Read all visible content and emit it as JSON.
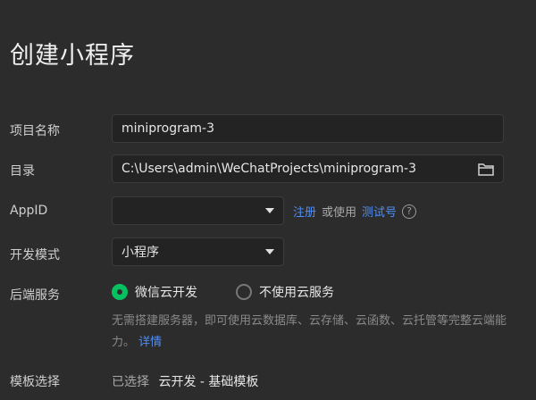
{
  "title": "创建小程序",
  "fields": {
    "project_name": {
      "label": "项目名称",
      "value": "miniprogram-3"
    },
    "directory": {
      "label": "目录",
      "value": "C:\\Users\\admin\\WeChatProjects\\miniprogram-3",
      "icon": "folder-icon"
    },
    "appid": {
      "label": "AppID",
      "value": "",
      "register_link": "注册",
      "or_use": "或使用",
      "test_link": "测试号",
      "help_icon": "question-circle-icon"
    },
    "dev_mode": {
      "label": "开发模式",
      "value": "小程序"
    },
    "backend": {
      "label": "后端服务",
      "options": [
        {
          "label": "微信云开发",
          "selected": true
        },
        {
          "label": "不使用云服务",
          "selected": false
        }
      ],
      "description": "无需搭建服务器，即可使用云数据库、云存储、云函数、云托管等完整云端能力。",
      "details_link": "详情"
    },
    "template": {
      "label": "模板选择",
      "selected_prefix": "已选择",
      "selected_value": "云开发 - 基础模板"
    }
  },
  "colors": {
    "accent_green": "#07c160",
    "link_blue": "#4e8ef7",
    "background": "#2c2c2c"
  }
}
